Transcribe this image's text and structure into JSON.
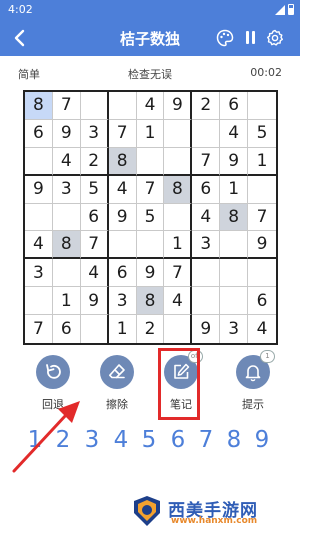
{
  "status_bar": {
    "time": "4:02"
  },
  "app_bar": {
    "back_icon": "arrow-left-icon",
    "title": "桔子数独",
    "icons": [
      "palette-icon",
      "pause-icon",
      "gear-icon"
    ]
  },
  "info": {
    "difficulty": "简单",
    "check": "检查无误",
    "timer": "00:02"
  },
  "board": {
    "cells": [
      [
        "8",
        "7",
        "",
        "",
        "4",
        "9",
        "2",
        "6",
        ""
      ],
      [
        "6",
        "9",
        "3",
        "7",
        "1",
        "",
        "",
        "4",
        "5"
      ],
      [
        "",
        "4",
        "2",
        "8",
        "",
        "",
        "7",
        "9",
        "1"
      ],
      [
        "9",
        "3",
        "5",
        "4",
        "7",
        "8",
        "6",
        "1",
        ""
      ],
      [
        "",
        "",
        "6",
        "9",
        "5",
        "",
        "4",
        "8",
        "7"
      ],
      [
        "4",
        "8",
        "7",
        "",
        "",
        "1",
        "3",
        "",
        "9"
      ],
      [
        "3",
        "",
        "4",
        "6",
        "9",
        "7",
        "",
        "",
        ""
      ],
      [
        "",
        "1",
        "9",
        "3",
        "8",
        "4",
        "",
        "",
        "6"
      ],
      [
        "7",
        "6",
        "",
        "1",
        "2",
        "",
        "9",
        "3",
        "4"
      ]
    ],
    "selected_cell": [
      0,
      0
    ],
    "highlighted_cells": [
      [
        2,
        3
      ],
      [
        3,
        5
      ],
      [
        4,
        7
      ],
      [
        5,
        1
      ],
      [
        7,
        4
      ]
    ],
    "colors": {
      "selected": "#c7d9f7",
      "same_number": "#cfd4dc"
    }
  },
  "tools": {
    "undo": {
      "label": "回退",
      "icon": "undo-icon"
    },
    "erase": {
      "label": "擦除",
      "icon": "eraser-icon"
    },
    "notes": {
      "label": "笔记",
      "icon": "pencil-edit-icon",
      "badge": "off"
    },
    "hint": {
      "label": "提示",
      "icon": "bell-icon",
      "badge": "1"
    }
  },
  "numpad": [
    "1",
    "2",
    "3",
    "4",
    "5",
    "6",
    "7",
    "8",
    "9"
  ],
  "watermark": {
    "title": "西美手游网",
    "url": "www.hanxm.com"
  },
  "colors": {
    "primary": "#4d7fd9",
    "tool_button": "#6e89b6",
    "annotation": "#e22a2a"
  }
}
